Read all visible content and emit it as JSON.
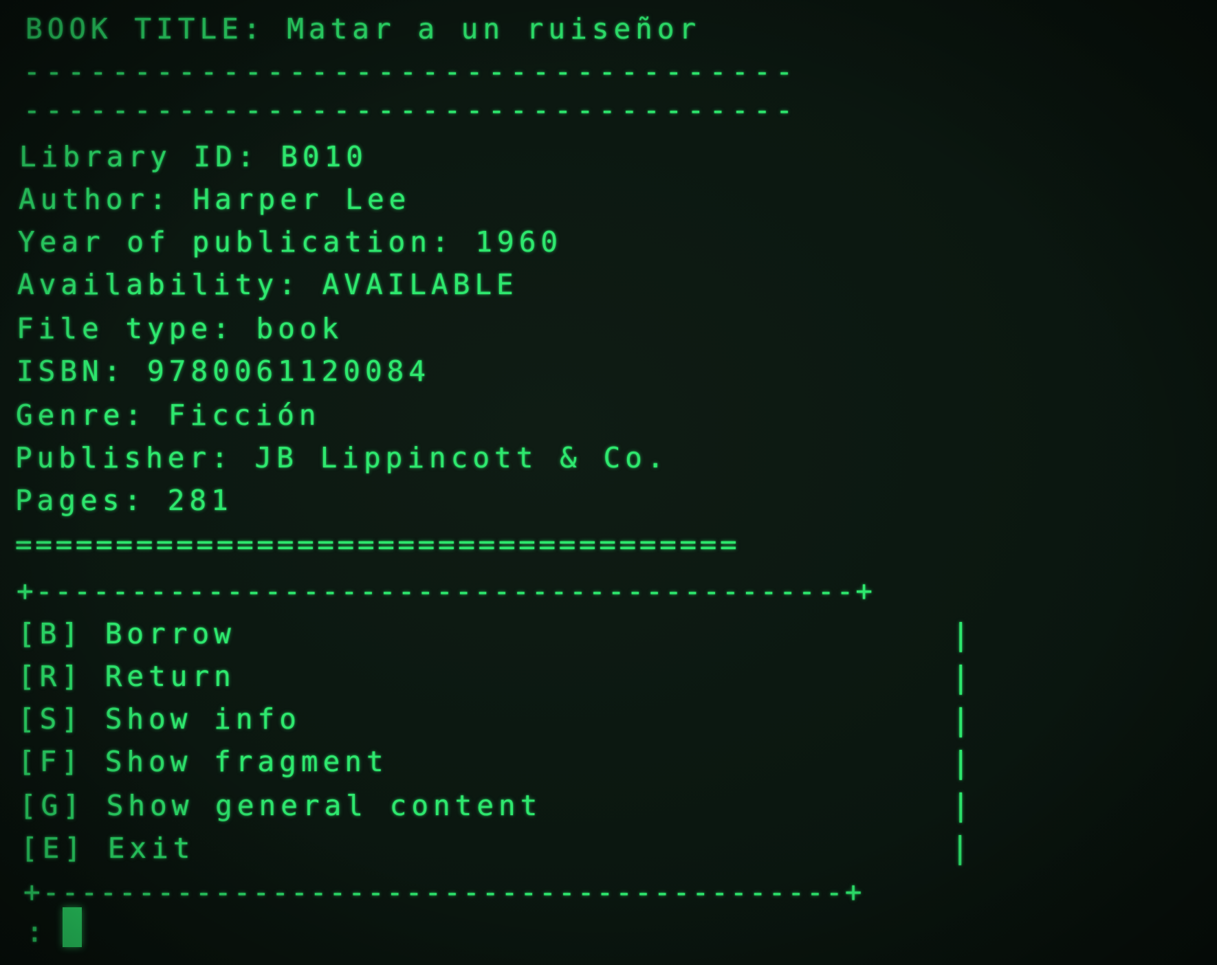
{
  "colors": {
    "phosphor": "#2ee86e",
    "background": "#0b1710"
  },
  "header": {
    "title_line": "BOOK TITLE: Matar a un ruiseñor",
    "dash_rule_1": "-----------------------------------",
    "dash_rule_2": "-----------------------------------"
  },
  "details": {
    "library_id": "Library ID: B010",
    "author": "Author: Harper Lee",
    "year": "Year of publication: 1960",
    "availability": "Availability: AVAILABLE",
    "file_type": "File type: book",
    "isbn": "ISBN: 9780061120084",
    "genre": "Genre: Ficción",
    "publisher": "Publisher: JB Lippincott & Co.",
    "pages": "Pages: 281"
  },
  "separator": "====================================",
  "menu": {
    "top_border": "+-------------------------------------------+",
    "bottom_border": "+------------------------------------------+",
    "side_char": "|",
    "items": [
      {
        "label": "[B] Borrow"
      },
      {
        "label": "[R] Return"
      },
      {
        "label": "[S] Show info"
      },
      {
        "label": "[F] Show fragment"
      },
      {
        "label": "[G] Show general content"
      },
      {
        "label": "[E] Exit"
      }
    ]
  },
  "prompt": {
    "symbol": ":"
  }
}
